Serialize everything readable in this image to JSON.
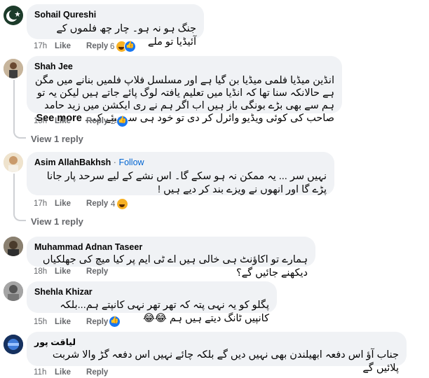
{
  "comments": [
    {
      "name": "Sohail Qureshi",
      "text": "جنگ ہو نہ ہو۔ چار چھ فلموں کے آئیڈیا تو ملے",
      "time": "17h",
      "like": "Like",
      "reply": "Reply",
      "reaction_count": "6",
      "reactions": [
        "haha-icon",
        "like-icon"
      ]
    },
    {
      "name": "Shah Jee",
      "text": "انڈین میڈیا فلمی میڈیا بن گیا ہے اور مسلسل فلاپ فلمیں بنانے میں مگن ہے حالانکہ سنا تھا کہ انڈیا میں تعلیم یافتہ لوگ پائے جاتے ہیں لیکن یہ تو ہم سے بھی بڑے بونگی باز ہیں اب اگر ہم نے ری ایکشن میں زید حامد صاحب کی کوئی ویڈیو وائرل کر دی تو خود ہی سوچیئے ک...",
      "see_more": "See more",
      "time": "15h",
      "like": "Like",
      "reply": "Reply",
      "reaction_count": "2",
      "reactions": [
        "like-icon"
      ],
      "view_reply": "View 1 reply"
    },
    {
      "name": "Asim AllahBakhsh",
      "separator": "·",
      "follow": "Follow",
      "text": "نہیں سر ... یہ ممکن نہ ہو سکے گا۔ اس نشے کے لیے سرحد پار جانا پڑے گا اور انھوں نے ویزے بند کر دیے ہیں !",
      "time": "17h",
      "like": "Like",
      "reply": "Reply",
      "reaction_count": "4",
      "reactions": [
        "haha-icon"
      ],
      "view_reply": "View 1 reply"
    },
    {
      "name": "Muhammad Adnan Taseer",
      "text": "ہمارے تو اکاؤنٹ ہی خالی ہیں اے ٹی ایم پر کیا میچ کی جھلکیاں دیکھنے جائیں گے؟",
      "time": "18h",
      "like": "Like",
      "reply": "Reply"
    },
    {
      "name": "Shehla Khizar",
      "text": "پگلو کو یہ نہی پتہ کہ تھر تھر نہی کانپتے ہم...بلکہ کانپیں ٹانگ دیتے ہیں ہم 😂😂",
      "time": "15h",
      "like": "Like",
      "reply": "Reply",
      "reactions": [
        "like-icon"
      ]
    },
    {
      "name": "لیاقت پور",
      "text": "جناب آؤ اس دفعہ ابھیلندن بھی نہیں دیں گے بلکہ چائے نہیں اس دفعہ گڑ والا شربت پلائیں گے",
      "time": "11h",
      "like": "Like",
      "reply": "Reply"
    }
  ]
}
